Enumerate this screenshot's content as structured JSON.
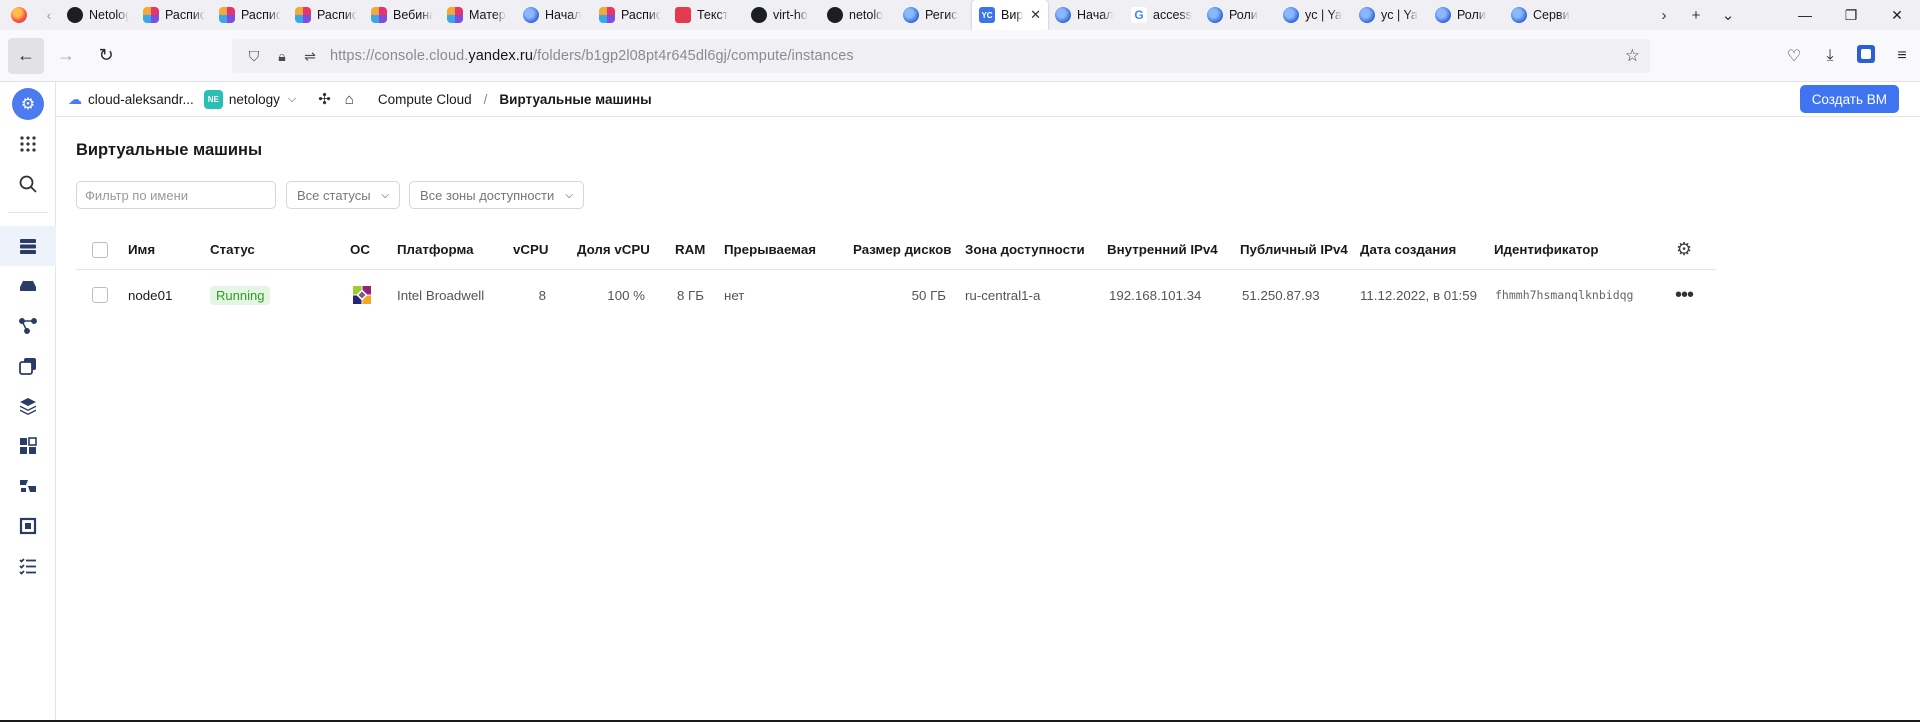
{
  "browser": {
    "tabs": [
      {
        "title": "Netology",
        "favicon": "github-icon"
      },
      {
        "title": "Распис",
        "favicon": "kaiten-icon"
      },
      {
        "title": "Распис",
        "favicon": "kaiten-icon"
      },
      {
        "title": "Распис",
        "favicon": "kaiten-icon"
      },
      {
        "title": "Вебинар",
        "favicon": "kaiten-icon"
      },
      {
        "title": "Матер",
        "favicon": "kaiten-icon"
      },
      {
        "title": "Начал",
        "favicon": "yandex-icon"
      },
      {
        "title": "Распис",
        "favicon": "kaiten-icon"
      },
      {
        "title": "Текст",
        "favicon": "tex-icon"
      },
      {
        "title": "virt-ho",
        "favicon": "github-icon"
      },
      {
        "title": "netolo",
        "favicon": "github-icon"
      },
      {
        "title": "Регис",
        "favicon": "yandex-icon"
      },
      {
        "title": "Вир",
        "favicon": "yc-icon",
        "active": true,
        "favicon_text": "YC"
      },
      {
        "title": "Начал",
        "favicon": "yandex-icon"
      },
      {
        "title": "access",
        "favicon": "google-icon",
        "favicon_text": "G"
      },
      {
        "title": "Роли",
        "favicon": "yandex-icon"
      },
      {
        "title": "yc | Ya",
        "favicon": "yandex-icon"
      },
      {
        "title": "yc | Ya",
        "favicon": "yandex-icon"
      },
      {
        "title": "Роли",
        "favicon": "yandex-icon"
      },
      {
        "title": "Серви",
        "favicon": "yandex-icon"
      }
    ],
    "url_prefix": "https://console.cloud.",
    "url_host": "yandex.ru",
    "url_path": "/folders/b1gp2l08pt4r645dl6gj/compute/instances"
  },
  "console": {
    "cloud_name": "cloud-aleksandr...",
    "folder_badge": "NE",
    "folder_name": "netology",
    "breadcrumb_service": "Compute Cloud",
    "breadcrumb_separator": "/",
    "breadcrumb_current": "Виртуальные машины",
    "create_button": "Создать ВМ",
    "page_title": "Виртуальные машины",
    "filter_placeholder": "Фильтр по имени",
    "status_filter": "Все статусы",
    "zone_filter": "Все зоны доступности",
    "columns": {
      "name": "Имя",
      "status": "Статус",
      "os": "ОС",
      "platform": "Платформа",
      "vcpu": "vCPU",
      "vcpu_share": "Доля vCPU",
      "ram": "RAM",
      "preemptible": "Прерываемая",
      "disk_size": "Размер дисков",
      "zone": "Зона доступности",
      "internal_ip": "Внутренний IPv4",
      "public_ip": "Публичный IPv4",
      "created": "Дата создания",
      "id": "Идентификатор"
    },
    "rows": [
      {
        "name": "node01",
        "status": "Running",
        "os": "centos-icon",
        "platform": "Intel Broadwell",
        "vcpu": "8",
        "vcpu_share": "100 %",
        "ram": "8 ГБ",
        "preemptible": "нет",
        "disk_size": "50 ГБ",
        "zone": "ru-central1-a",
        "internal_ip": "192.168.101.34",
        "public_ip": "51.250.87.93",
        "created": "11.12.2022, в 01:59",
        "id": "fhmmh7hsmanqlknbidqg"
      }
    ]
  },
  "colors": {
    "accent": "#3f74f0",
    "running_bg": "#e5f5e3",
    "running_fg": "#2f9b29"
  }
}
